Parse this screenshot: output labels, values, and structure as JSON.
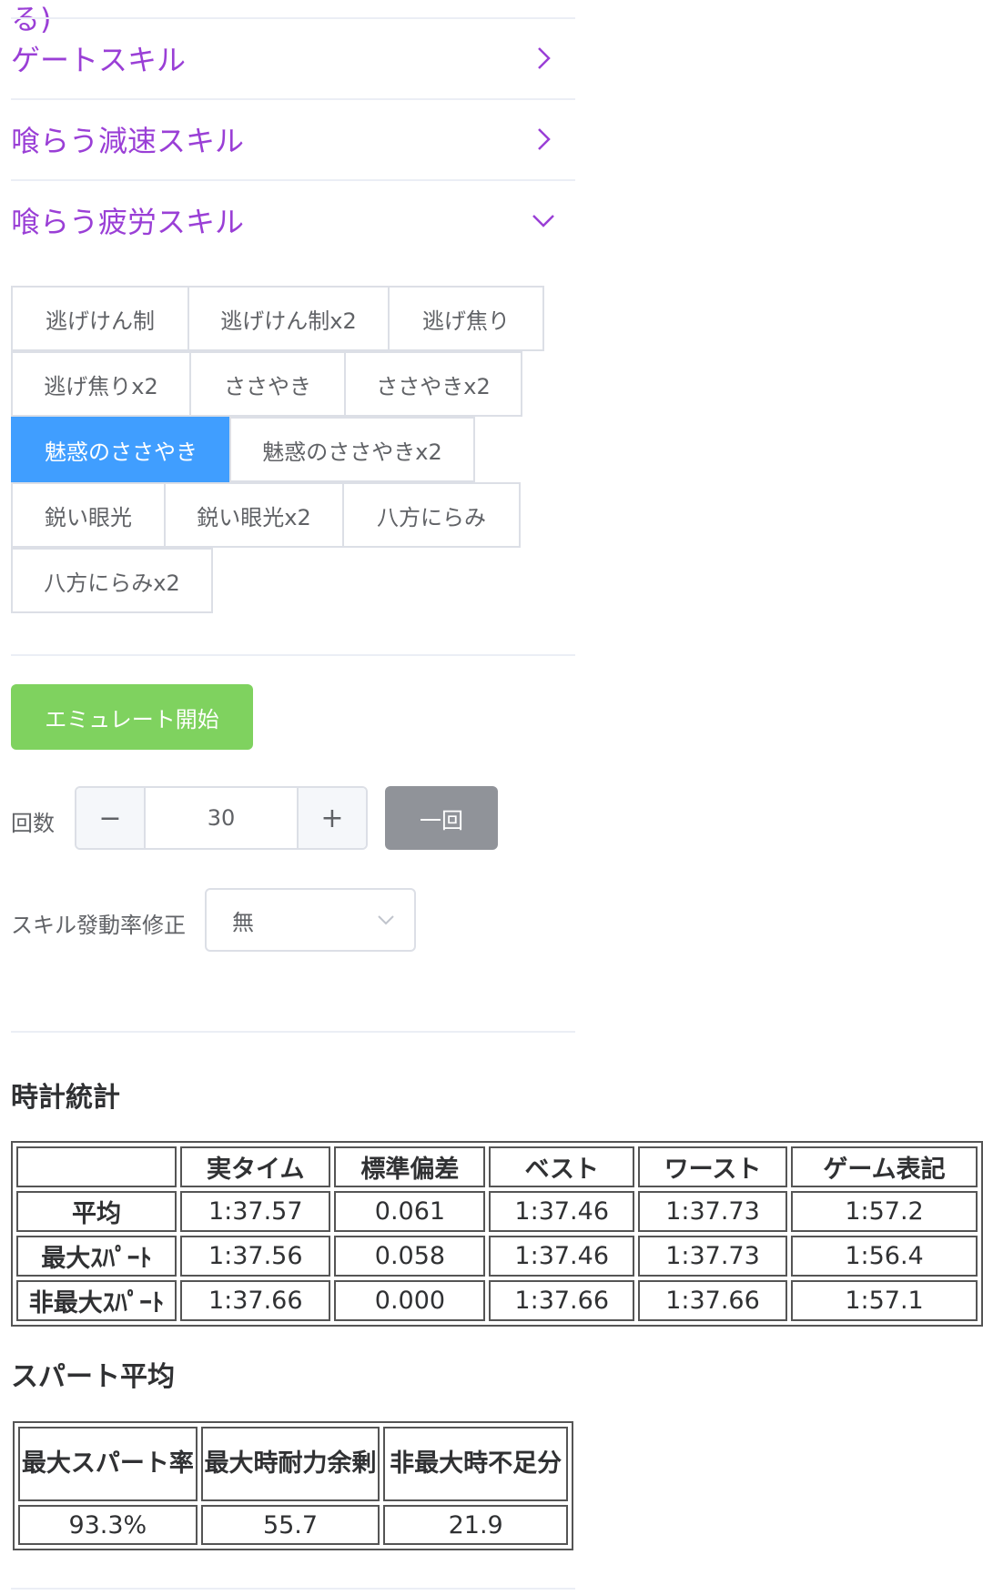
{
  "top_fragment": "る)",
  "collapses": [
    {
      "title": "ゲートスキル",
      "expanded": false
    },
    {
      "title": "喰らう減速スキル",
      "expanded": false
    },
    {
      "title": "喰らう疲労スキル",
      "expanded": true
    }
  ],
  "fatigue_skills": [
    {
      "label": "逃げけん制",
      "active": false
    },
    {
      "label": "逃げけん制x2",
      "active": false
    },
    {
      "label": "逃げ焦り",
      "active": false
    },
    {
      "label": "逃げ焦りx2",
      "active": false
    },
    {
      "label": "ささやき",
      "active": false
    },
    {
      "label": "ささやきx2",
      "active": false
    },
    {
      "label": "魅惑のささやき",
      "active": true
    },
    {
      "label": "魅惑のささやきx2",
      "active": false
    },
    {
      "label": "鋭い眼光",
      "active": false
    },
    {
      "label": "鋭い眼光x2",
      "active": false
    },
    {
      "label": "八方にらみ",
      "active": false
    },
    {
      "label": "八方にらみx2",
      "active": false
    }
  ],
  "controls": {
    "emulate_label": "エミュレート開始",
    "count_label": "回数",
    "count_minus": "−",
    "count_value": "30",
    "count_plus": "+",
    "once_label": "一回",
    "skill_rate_label": "スキル發動率修正",
    "skill_rate_value": "無"
  },
  "clock_stats": {
    "title": "時計統計",
    "headers": [
      "",
      "実タイム",
      "標準偏差",
      "ベスト",
      "ワースト",
      "ゲーム表記"
    ],
    "rows": [
      [
        "平均",
        "1:37.57",
        "0.061",
        "1:37.46",
        "1:37.73",
        "1:57.2"
      ],
      [
        "最大ｽﾊﾟｰﾄ",
        "1:37.56",
        "0.058",
        "1:37.46",
        "1:37.73",
        "1:56.4"
      ],
      [
        "非最大ｽﾊﾟｰﾄ",
        "1:37.66",
        "0.000",
        "1:37.66",
        "1:37.66",
        "1:57.1"
      ]
    ]
  },
  "spurt_avg": {
    "title": "スパート平均",
    "headers": [
      "最大スパート率",
      "最大時耐力余剰",
      "非最大時不足分"
    ],
    "values": [
      "93.3%",
      "55.7",
      "21.9"
    ]
  },
  "colors": {
    "collapse_title": "#9a3fd6",
    "chip_active": "#409eff",
    "emulate_button": "#7fd25f",
    "once_button": "#909399"
  }
}
